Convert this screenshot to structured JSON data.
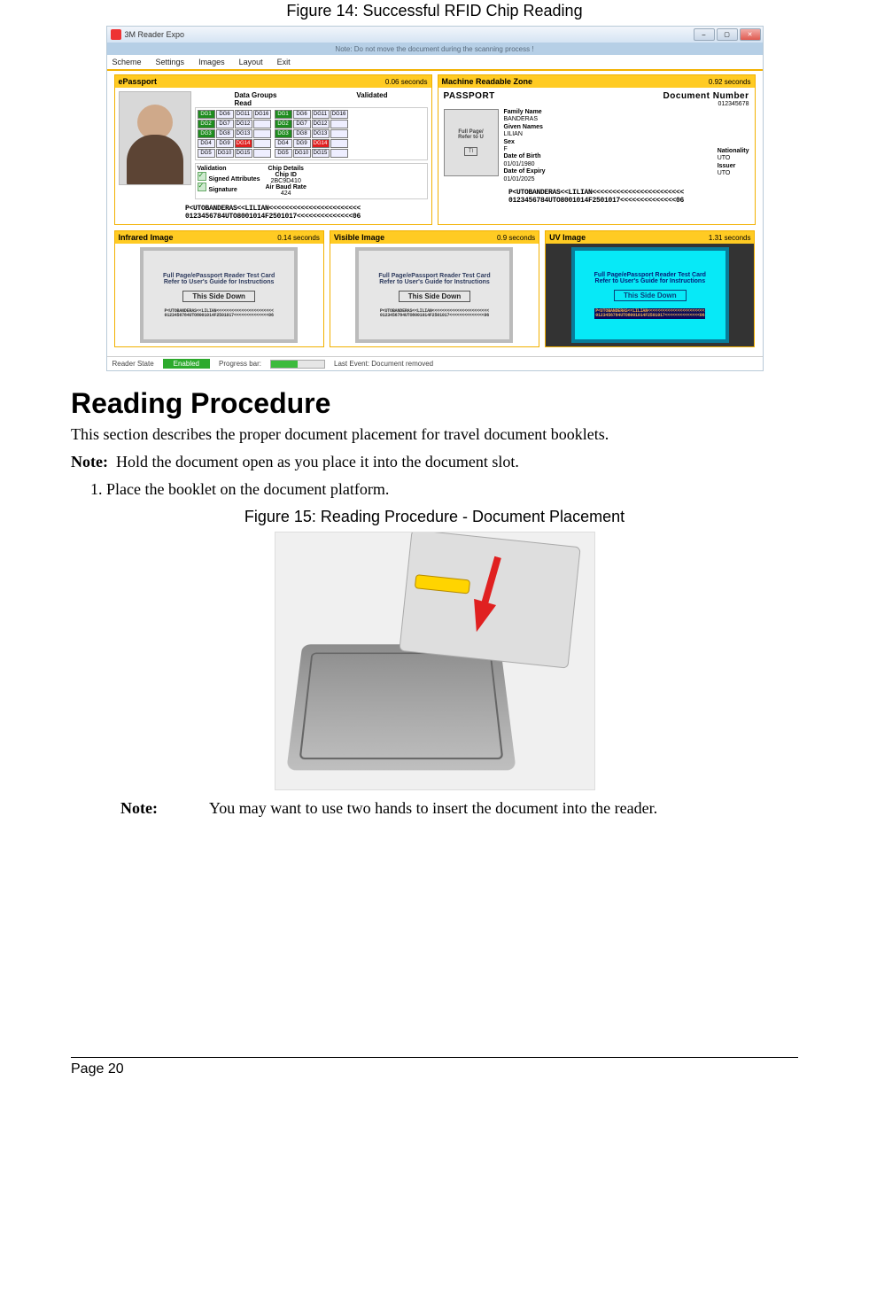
{
  "fig14": {
    "caption": "Figure 14: Successful RFID Chip Reading",
    "window_title": "3M Reader Expo",
    "bluebar_text": "Note: Do not move the document during the scanning process !",
    "menus": [
      "Scheme",
      "Settings",
      "Images",
      "Layout",
      "Exit"
    ],
    "epassport": {
      "name": "ePassport",
      "time": "0.06 seconds",
      "dg_headers": {
        "read": "Data Groups\nRead",
        "validated": "Validated"
      },
      "validation_label": "Validation",
      "validation_items": [
        "Signed Attributes",
        "Signature"
      ],
      "chip_label": "Chip Details",
      "chip_id_label": "Chip ID",
      "chip_id": "2BC9D410",
      "baud_label": "Air Baud Rate",
      "baud": "424",
      "mrz1": "P<UTOBANDERAS<<LILIAN<<<<<<<<<<<<<<<<<<<<<<<",
      "mrz2": "0123456784UTO8001014F2501017<<<<<<<<<<<<<<06"
    },
    "mrzpanel": {
      "name": "Machine Readable Zone",
      "time": "0.92 seconds",
      "type": "PASSPORT",
      "docnum_label": "Document Number",
      "docnum": "012345678",
      "card_l1": "Full Page/",
      "card_l2": "Refer to U",
      "field_family_l": "Family Name",
      "field_family": "BANDERAS",
      "field_given_l": "Given Names",
      "field_given": "LILIAN",
      "field_sex_l": "Sex",
      "field_sex": "F",
      "field_dob_l": "Date of Birth",
      "field_dob": "01/01/1980",
      "field_nat_l": "Nationality",
      "field_nat": "UTO",
      "field_exp_l": "Date of Expiry",
      "field_exp": "01/01/2025",
      "field_iss_l": "Issuer",
      "field_iss": "UTO",
      "mrz1": "P<UTOBANDERAS<<LILIAN<<<<<<<<<<<<<<<<<<<<<<<",
      "mrz2": "0123456784UTO8001014F2501017<<<<<<<<<<<<<<06"
    },
    "ir": {
      "name": "Infrared Image",
      "time": "0.14 seconds"
    },
    "vis": {
      "name": "Visible Image",
      "time": "0.9 seconds"
    },
    "uv": {
      "name": "UV Image",
      "time": "1.31 seconds"
    },
    "card": {
      "l1": "Full Page/ePassport Reader Test Card",
      "l2": "Refer to User's Guide for Instructions",
      "tsd": "This Side Down",
      "mrz1": "P<UTOBANDERAS<<LILIAN<<<<<<<<<<<<<<<<<<<<<<<",
      "mrz2": "0123456784UTO8001014F2501017<<<<<<<<<<<<<<06"
    },
    "status": {
      "reader_state_l": "Reader State",
      "enabled": "Enabled",
      "progress_l": "Progress bar:",
      "last_event": "Last Event: Document removed"
    }
  },
  "section_heading": "Reading Procedure",
  "intro": "This section describes the proper document placement for travel document booklets.",
  "note1_label": "Note:",
  "note1_text": "Hold the document open as you place it into the document slot.",
  "step1": "Place the booklet on the document platform.",
  "fig15_caption": "Figure 15: Reading Procedure - Document Placement",
  "note2_label": "Note:",
  "note2_text": "You may want to use two hands to insert the document into the reader.",
  "page_num": "Page 20"
}
